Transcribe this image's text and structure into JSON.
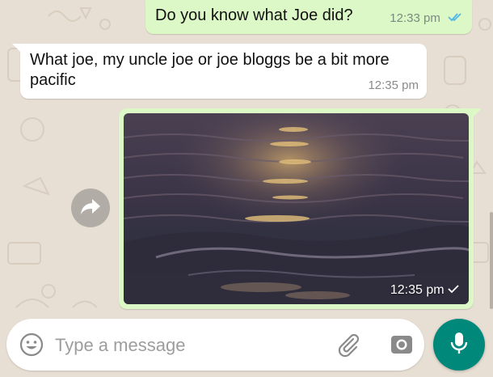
{
  "messages": [
    {
      "direction": "outgoing",
      "text": "Do you know what Joe did?",
      "time": "12:33 pm",
      "status_icon": "double-check-read-icon"
    },
    {
      "direction": "incoming",
      "text": "What joe, my uncle joe or joe bloggs be a bit more pacific",
      "time": "12:35 pm"
    },
    {
      "direction": "outgoing",
      "type": "image",
      "image_description_icon": "sunset-sea-photo",
      "time": "12:35 pm",
      "status_icon": "single-check-sent-icon"
    }
  ],
  "composer": {
    "placeholder": "Type a message",
    "emoji_icon": "emoji-icon",
    "attach_icon": "paperclip-icon",
    "camera_icon": "camera-icon",
    "mic_icon": "microphone-icon"
  },
  "colors": {
    "outgoing_bubble": "#dcf8c6",
    "incoming_bubble": "#ffffff",
    "read_ticks": "#4fb6ec",
    "mic_button": "#00897b",
    "wallpaper": "#e8dfd4"
  }
}
